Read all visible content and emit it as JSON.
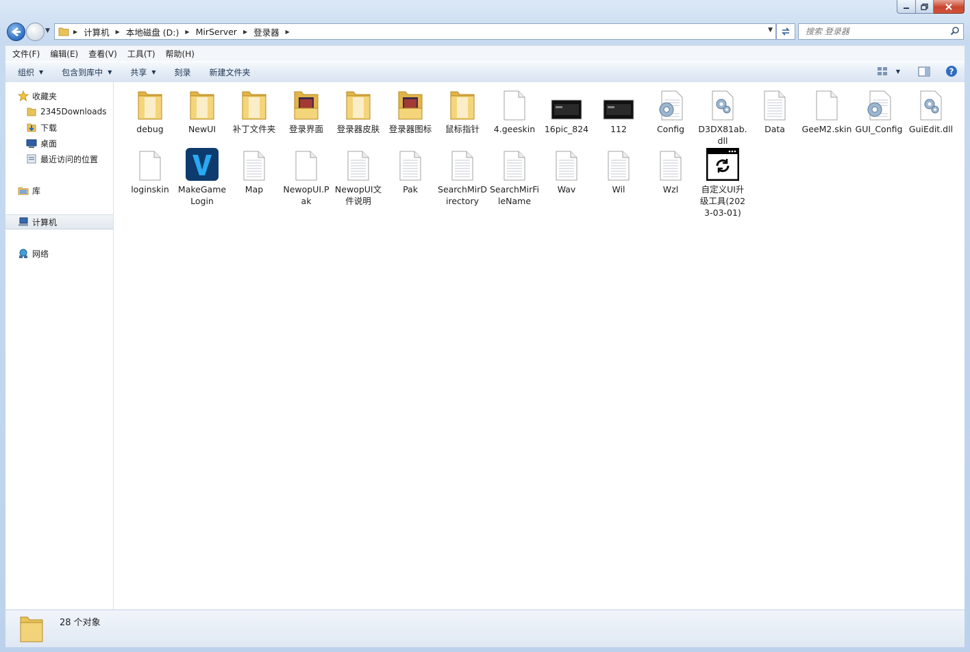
{
  "address": {
    "crumbs": [
      "计算机",
      "本地磁盘 (D:)",
      "MirServer",
      "登录器"
    ]
  },
  "search": {
    "placeholder": "搜索 登录器"
  },
  "menu": [
    "文件(F)",
    "编辑(E)",
    "查看(V)",
    "工具(T)",
    "帮助(H)"
  ],
  "toolbar": {
    "organize": "组织",
    "include": "包含到库中",
    "share": "共享",
    "burn": "刻录",
    "new_folder": "新建文件夹"
  },
  "nav": {
    "favorites": "收藏夹",
    "downloads_2345": "2345Downloads",
    "downloads": "下载",
    "desktop": "桌面",
    "recent": "最近访问的位置",
    "libraries": "库",
    "computer": "计算机",
    "network": "网络"
  },
  "files": [
    {
      "name": "debug",
      "icon": "folder-icon"
    },
    {
      "name": "NewUI",
      "icon": "folder-icon"
    },
    {
      "name": "补丁文件夹",
      "icon": "folder-icon"
    },
    {
      "name": "登录界面",
      "icon": "folder-image-icon"
    },
    {
      "name": "登录器皮肤",
      "icon": "folder-icon"
    },
    {
      "name": "登录器图标",
      "icon": "folder-image-icon"
    },
    {
      "name": "鼠标指针",
      "icon": "folder-icon"
    },
    {
      "name": "4.geeskin",
      "icon": "blank-file-icon"
    },
    {
      "name": "16pic_824",
      "icon": "image-thumbnail-icon"
    },
    {
      "name": "112",
      "icon": "image-thumbnail-icon"
    },
    {
      "name": "Config",
      "icon": "config-file-icon"
    },
    {
      "name": "D3DX81ab.dll",
      "icon": "dll-file-icon"
    },
    {
      "name": "Data",
      "icon": "text-file-icon"
    },
    {
      "name": "GeeM2.skin",
      "icon": "blank-file-icon"
    },
    {
      "name": "GUI_Config",
      "icon": "config-file-icon"
    },
    {
      "name": "GuiEdit.dll",
      "icon": "dll-file-icon"
    },
    {
      "name": "loginskin",
      "icon": "blank-file-icon"
    },
    {
      "name": "MakeGameLogin",
      "icon": "app-v-icon"
    },
    {
      "name": "Map",
      "icon": "text-file-icon"
    },
    {
      "name": "NewopUI.Pak",
      "icon": "blank-file-icon"
    },
    {
      "name": "NewopUI文件说明",
      "icon": "text-file-icon"
    },
    {
      "name": "Pak",
      "icon": "text-file-icon"
    },
    {
      "name": "SearchMirDirectory",
      "icon": "text-file-icon"
    },
    {
      "name": "SearchMirFileName",
      "icon": "text-file-icon"
    },
    {
      "name": "Wav",
      "icon": "text-file-icon"
    },
    {
      "name": "Wil",
      "icon": "text-file-icon"
    },
    {
      "name": "Wzl",
      "icon": "text-file-icon"
    },
    {
      "name": "自定义UI升级工具(2023-03-01)",
      "icon": "app-update-icon"
    }
  ],
  "status": {
    "count": "28 个对象"
  }
}
